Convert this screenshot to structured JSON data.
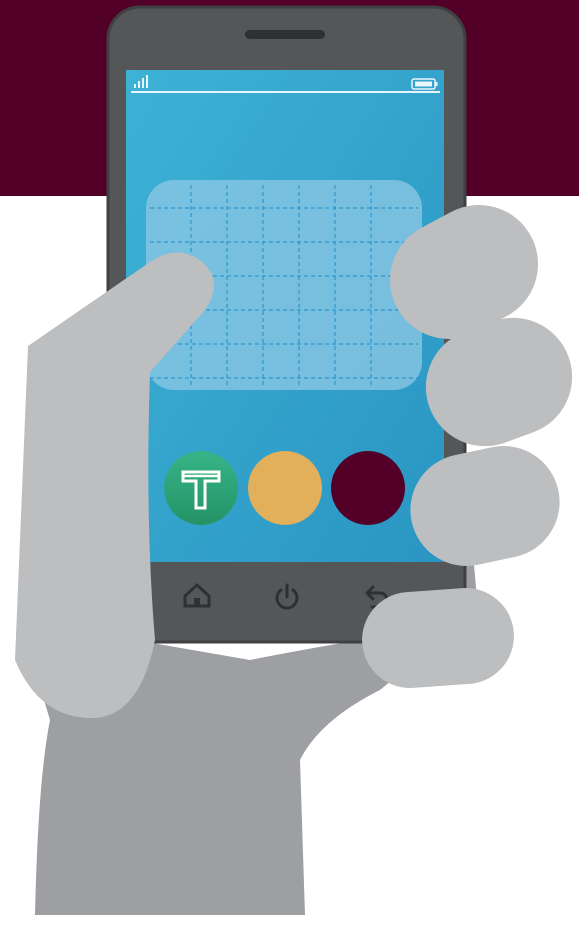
{
  "scene": {
    "banner_color": "#520028",
    "background_color": "#ffffff",
    "hand_color": "#bdbec0",
    "arm_color": "#9d9fa2",
    "phone_body_color": "#545658",
    "screen_color": "#2f9fc9",
    "widget_color": "#8fc8e6"
  },
  "phone": {
    "status_bar": {
      "signal_icon": "signal-bars-icon",
      "battery_icon": "battery-icon"
    },
    "apps": [
      {
        "name": "t-logo-app-icon",
        "color": "#2faa78",
        "glyph": "T"
      },
      {
        "name": "yellow-app-icon",
        "color": "#e2b05a"
      },
      {
        "name": "maroon-app-icon",
        "color": "#520028"
      }
    ],
    "nav_buttons": [
      {
        "name": "home-icon"
      },
      {
        "name": "power-icon"
      },
      {
        "name": "back-icon"
      }
    ]
  }
}
